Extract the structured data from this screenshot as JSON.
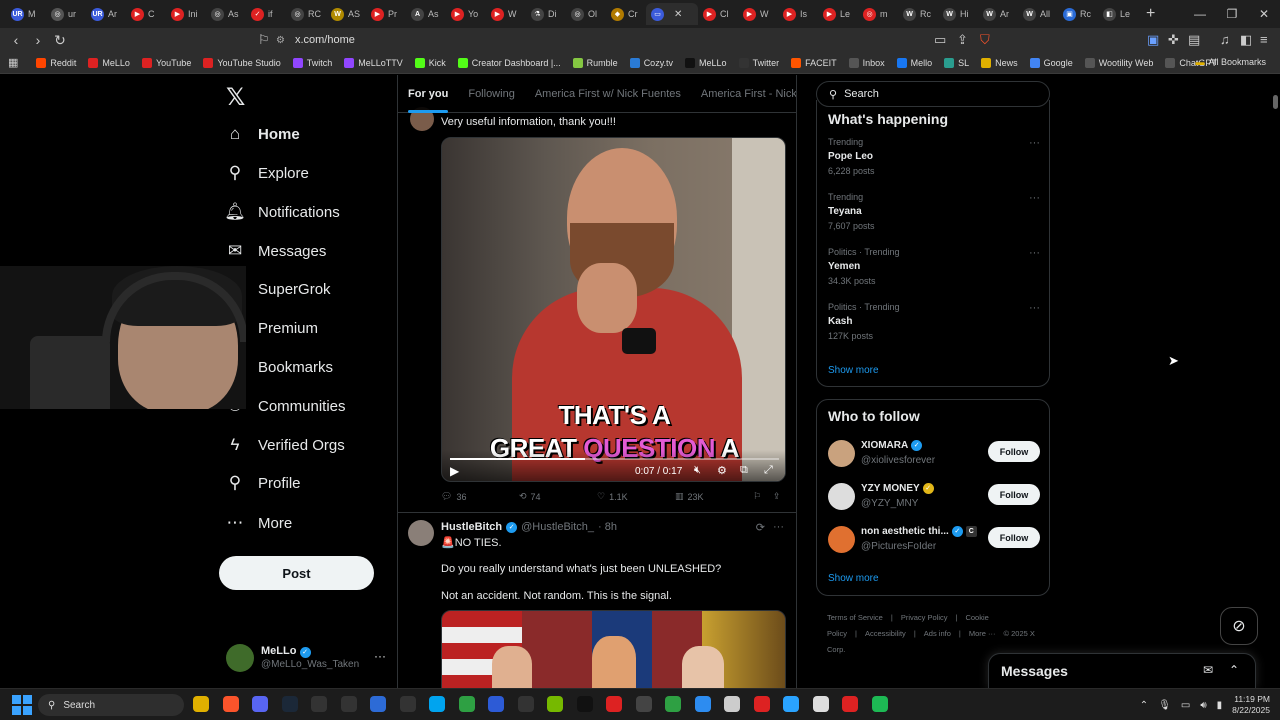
{
  "browser": {
    "tabs": [
      {
        "label": "M",
        "fav": "UR",
        "color": "#3b5bdb"
      },
      {
        "label": "ur",
        "fav": "◎",
        "color": "#555"
      },
      {
        "label": "Ar",
        "fav": "UR",
        "color": "#3b5bdb"
      },
      {
        "label": "C",
        "fav": "▶",
        "color": "#d22"
      },
      {
        "label": "Ini",
        "fav": "▶",
        "color": "#d22"
      },
      {
        "label": "As",
        "fav": "◎",
        "color": "#444"
      },
      {
        "label": "if",
        "fav": "✓",
        "color": "#d22"
      },
      {
        "label": "RC",
        "fav": "◎",
        "color": "#444"
      },
      {
        "label": "AS",
        "fav": "W",
        "color": "#b08a00"
      },
      {
        "label": "Pr",
        "fav": "▶",
        "color": "#d22"
      },
      {
        "label": "As",
        "fav": "A",
        "color": "#444"
      },
      {
        "label": "Yo",
        "fav": "▶",
        "color": "#d22"
      },
      {
        "label": "W",
        "fav": "▶",
        "color": "#d22"
      },
      {
        "label": "Di",
        "fav": "⚗",
        "color": "#444"
      },
      {
        "label": "Ol",
        "fav": "◎",
        "color": "#444"
      },
      {
        "label": "Cr",
        "fav": "◆",
        "color": "#b07a00"
      },
      {
        "label": "",
        "fav": "▭",
        "color": "#3b5bdb",
        "active": true
      },
      {
        "label": "Cl",
        "fav": "▶",
        "color": "#d22"
      },
      {
        "label": "W",
        "fav": "▶",
        "color": "#d22"
      },
      {
        "label": "Is",
        "fav": "▶",
        "color": "#d22"
      },
      {
        "label": "Le",
        "fav": "▶",
        "color": "#d22"
      },
      {
        "label": "m",
        "fav": "◎",
        "color": "#d22"
      },
      {
        "label": "Rc",
        "fav": "W",
        "color": "#444"
      },
      {
        "label": "Hi",
        "fav": "W",
        "color": "#444"
      },
      {
        "label": "Ar",
        "fav": "W",
        "color": "#444"
      },
      {
        "label": "All",
        "fav": "W",
        "color": "#444"
      },
      {
        "label": "Rc",
        "fav": "▣",
        "color": "#2a6bd6"
      },
      {
        "label": "Le",
        "fav": "◧",
        "color": "#444"
      }
    ],
    "url": "x.com/home",
    "bookmarks": [
      {
        "label": "Reddit",
        "color": "#ff4500"
      },
      {
        "label": "MeLLo",
        "color": "#d22"
      },
      {
        "label": "YouTube",
        "color": "#d22"
      },
      {
        "label": "YouTube Studio",
        "color": "#d22"
      },
      {
        "label": "Twitch",
        "color": "#9146ff"
      },
      {
        "label": "MeLLoTTV",
        "color": "#9146ff"
      },
      {
        "label": "Kick",
        "color": "#53fc18"
      },
      {
        "label": "Creator Dashboard |...",
        "color": "#53fc18"
      },
      {
        "label": "Rumble",
        "color": "#85c742"
      },
      {
        "label": "Cozy.tv",
        "color": "#2a7bd6"
      },
      {
        "label": "MeLLo",
        "color": "#111"
      },
      {
        "label": "Twitter",
        "color": "#333"
      },
      {
        "label": "FACEIT",
        "color": "#ff5500"
      },
      {
        "label": "Inbox",
        "color": "#555"
      },
      {
        "label": "Mello",
        "color": "#1877f2"
      },
      {
        "label": "SL",
        "color": "#2a9d8f"
      },
      {
        "label": "News",
        "color": "#e0b000"
      },
      {
        "label": "Google",
        "color": "#4285f4"
      },
      {
        "label": "Wootility Web",
        "color": "#555"
      },
      {
        "label": "ChatGPT",
        "color": "#555"
      }
    ],
    "all_bookmarks": "All Bookmarks"
  },
  "nav": {
    "items": [
      {
        "label": "Home",
        "icon": "home-icon",
        "glyph": "⌂"
      },
      {
        "label": "Explore",
        "icon": "search-icon",
        "glyph": "⚲"
      },
      {
        "label": "Notifications",
        "icon": "bell-icon",
        "glyph": "🔔︎"
      },
      {
        "label": "Messages",
        "icon": "envelope-icon",
        "glyph": "✉"
      },
      {
        "label": "SuperGrok",
        "icon": "grok-icon",
        "glyph": "⊘"
      },
      {
        "label": "Premium",
        "icon": "x-premium-icon",
        "glyph": "✕"
      },
      {
        "label": "Bookmarks",
        "icon": "bookmark-icon",
        "glyph": "⚐"
      },
      {
        "label": "Communities",
        "icon": "communities-icon",
        "glyph": "⚇"
      },
      {
        "label": "Verified Orgs",
        "icon": "lightning-icon",
        "glyph": "ϟ"
      },
      {
        "label": "Profile",
        "icon": "profile-icon",
        "glyph": "⚲"
      },
      {
        "label": "More",
        "icon": "more-circle-icon",
        "glyph": "⋯"
      }
    ],
    "post_label": "Post",
    "account": {
      "name": "MeLLo",
      "handle": "@MeLLo_Was_Taken"
    }
  },
  "feed": {
    "tabs": [
      "For you",
      "Following",
      "America First w/ Nick Fuentes",
      "America First - Nick Fu"
    ],
    "tweet1": {
      "header_partial": "...Top Gu...",
      "text": "Very useful information, thank you!!!",
      "caption_line1": "THAT'S A",
      "caption_line2a": "GREAT ",
      "caption_line2b": "QUESTION",
      "caption_line2c": " A",
      "video_time": "0:07 / 0:17",
      "video_progress": 0.41,
      "replies": "36",
      "reposts": "74",
      "likes": "1.1K",
      "views": "23K"
    },
    "tweet2": {
      "name": "HustleBitch",
      "handle": "@HustleBitch_",
      "time": "· 8h",
      "line1": "🚨NO TIES.",
      "line2": "Do you really understand what's just been UNLEASHED?",
      "line3": "Not an accident. Not random. This is the signal."
    }
  },
  "sidebar": {
    "search_placeholder": "Search",
    "trending_title": "What's happening",
    "trends": [
      {
        "context": "Trending",
        "topic": "Pope Leo",
        "count": "6,228 posts"
      },
      {
        "context": "Trending",
        "topic": "Teyana",
        "count": "7,607 posts"
      },
      {
        "context": "Politics · Trending",
        "topic": "Yemen",
        "count": "34.3K posts"
      },
      {
        "context": "Politics · Trending",
        "topic": "Kash",
        "count": "127K posts"
      }
    ],
    "show_more": "Show more",
    "wtf_title": "Who to follow",
    "follow_label": "Follow",
    "suggestions": [
      {
        "name": "XIOMARA",
        "handle": "@xiolivesforever",
        "badge": "blue",
        "color": "#c9a27e"
      },
      {
        "name": "YZY MONEY",
        "handle": "@YZY_MNY",
        "badge": "gold",
        "color": "#ddd"
      },
      {
        "name": "non aesthetic thi...",
        "handle": "@PicturesFoIder",
        "badge": "blue",
        "color": "#e07030"
      }
    ],
    "footer": [
      "Terms of Service",
      "|",
      "Privacy Policy",
      "|",
      "Cookie Policy",
      "|",
      "Accessibility",
      "|",
      "Ads info",
      "|",
      "More ···",
      "© 2025 X Corp."
    ]
  },
  "messages_drawer": {
    "title": "Messages"
  },
  "taskbar": {
    "search_label": "Search",
    "time": "11:19 PM",
    "date": "8/22/2025"
  }
}
